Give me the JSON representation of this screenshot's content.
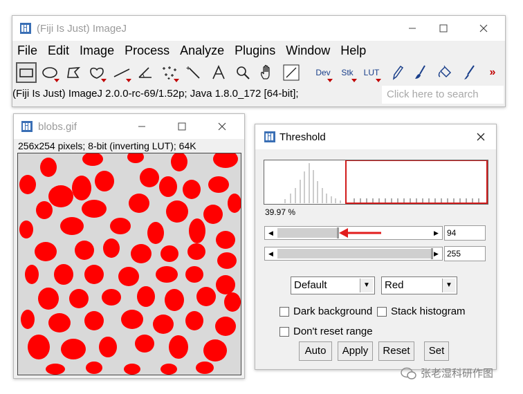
{
  "main_window": {
    "title": "(Fiji Is Just) ImageJ",
    "menu": [
      "File",
      "Edit",
      "Image",
      "Process",
      "Analyze",
      "Plugins",
      "Window",
      "Help"
    ],
    "tools": [
      {
        "name": "rectangle-tool-icon"
      },
      {
        "name": "oval-tool-icon"
      },
      {
        "name": "polygon-tool-icon"
      },
      {
        "name": "freehand-tool-icon"
      },
      {
        "name": "line-tool-icon"
      },
      {
        "name": "angle-tool-icon"
      },
      {
        "name": "point-tool-icon"
      },
      {
        "name": "wand-tool-icon"
      },
      {
        "name": "text-tool-icon"
      },
      {
        "name": "magnifier-tool-icon"
      },
      {
        "name": "hand-tool-icon"
      },
      {
        "name": "color-picker-tool-icon"
      },
      {
        "name": "dev-tool",
        "label": "Dev"
      },
      {
        "name": "stk-tool",
        "label": "Stk"
      },
      {
        "name": "lut-tool",
        "label": "LUT"
      },
      {
        "name": "pencil-tool-icon"
      },
      {
        "name": "paintbrush-tool-icon"
      },
      {
        "name": "flood-fill-tool-icon"
      },
      {
        "name": "pipette-tool-icon"
      },
      {
        "name": "more-tools-icon",
        "label": "»"
      }
    ],
    "status": "(Fiji Is Just) ImageJ 2.0.0-rc-69/1.52p; Java 1.8.0_172 [64-bit];",
    "search_placeholder": "Click here to search"
  },
  "image_window": {
    "title": "blobs.gif",
    "info": "256x254 pixels; 8-bit (inverting LUT); 64K",
    "overlay_color": "#ff0000"
  },
  "threshold_window": {
    "title": "Threshold",
    "percent": "39.97 %",
    "lower_value": "94",
    "upper_value": "255",
    "method": "Default",
    "display": "Red",
    "dark_background": "Dark background",
    "stack_histogram": "Stack histogram",
    "dont_reset_range": "Don't reset range",
    "buttons": [
      "Auto",
      "Apply",
      "Reset",
      "Set"
    ],
    "arrow_color": "#e21c1c",
    "selection_color": "#d11a1a"
  },
  "watermark": "张老湿科研作图"
}
